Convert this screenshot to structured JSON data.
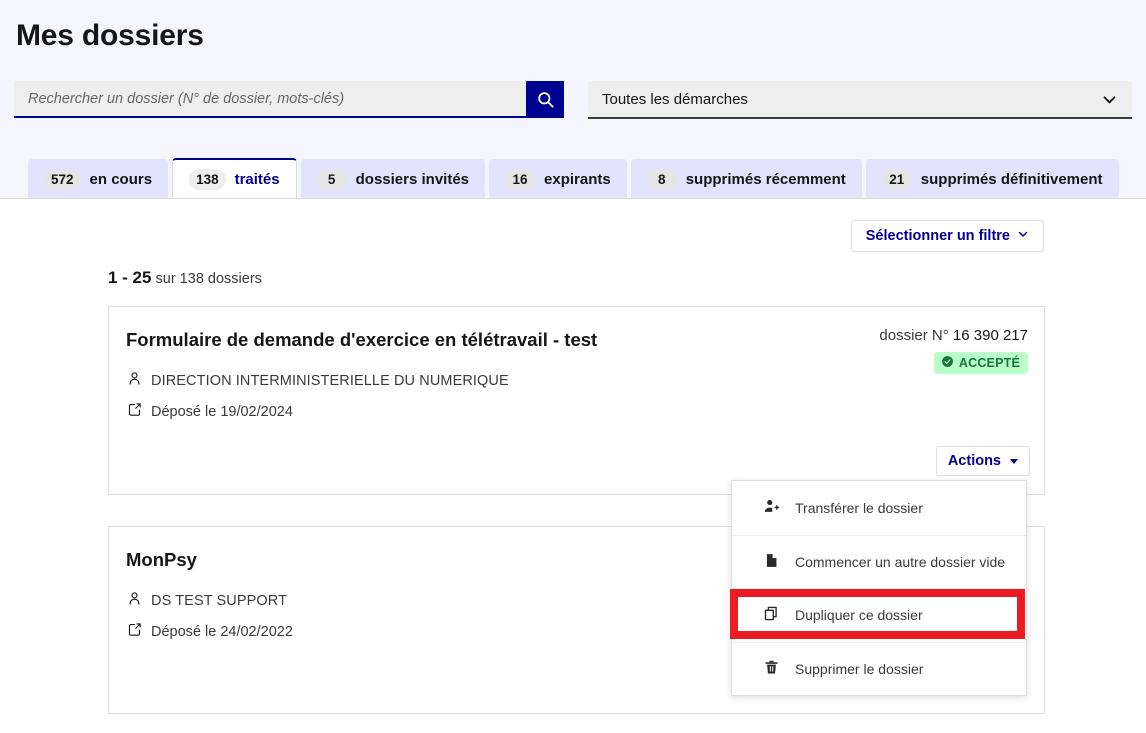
{
  "header": {
    "title": "Mes dossiers",
    "search": {
      "placeholder": "Rechercher un dossier (N° de dossier, mots-clés)",
      "value": "",
      "button_icon": "search-icon"
    },
    "procedure_select": {
      "value": "Toutes les démarches",
      "chevron_icon": "chevron-down-icon"
    }
  },
  "tabs": [
    {
      "count": "572",
      "label": "en cours",
      "active": false
    },
    {
      "count": "138",
      "label": "traités",
      "active": true
    },
    {
      "count": "5",
      "label": "dossiers invités",
      "active": false
    },
    {
      "count": "16",
      "label": "expirants",
      "active": false
    },
    {
      "count": "8",
      "label": "supprimés récemment",
      "active": false
    },
    {
      "count": "21",
      "label": "supprimés définitivement",
      "active": false
    }
  ],
  "toolbar": {
    "filter_label": "Sélectionner un filtre",
    "filter_chevron_icon": "chevron-down-icon"
  },
  "results": {
    "range": "1 - 25",
    "suffix": "sur 138 dossiers"
  },
  "cards": [
    {
      "title": "Formulaire de demande d'exercice en télétravail - test",
      "organisation": "DIRECTION INTERMINISTERIELLE DU NUMERIQUE",
      "org_icon": "user-icon",
      "date": "Déposé le 19/02/2024",
      "date_icon": "edit-square-icon",
      "dossier_label": "dossier N°",
      "dossier_number": "16 390 217",
      "status": "ACCEPTÉ",
      "status_icon": "check-circle-icon",
      "status_bg": "#b8fec9",
      "status_color": "#18753c",
      "actions_label": "Actions"
    },
    {
      "title": "MonPsy",
      "organisation": "DS TEST SUPPORT",
      "org_icon": "user-icon",
      "date": "Déposé le 24/02/2022",
      "date_icon": "edit-square-icon",
      "dossier_label": "",
      "dossier_number": "",
      "status": "",
      "status_icon": "",
      "status_bg": "",
      "status_color": "",
      "actions_label": ""
    }
  ],
  "actions_menu": {
    "open": true,
    "items": [
      {
        "label": "Transférer le dossier",
        "icon": "person-add-icon",
        "highlighted": false
      },
      {
        "label": "Commencer un autre dossier vide",
        "icon": "file-icon",
        "highlighted": false
      },
      {
        "label": "Dupliquer ce dossier",
        "icon": "copy-icon",
        "highlighted": true
      },
      {
        "label": "Supprimer le dossier",
        "icon": "trash-icon",
        "highlighted": false
      }
    ]
  },
  "annotation": {
    "highlight_color": "#ec1c24",
    "target": "Dupliquer ce dossier"
  },
  "colors": {
    "page_bg": "#f5f5fe",
    "brand_blue": "#000091",
    "tab_bg": "#e3e3fd",
    "input_bg": "#eeeeee",
    "border": "#dddddd"
  }
}
